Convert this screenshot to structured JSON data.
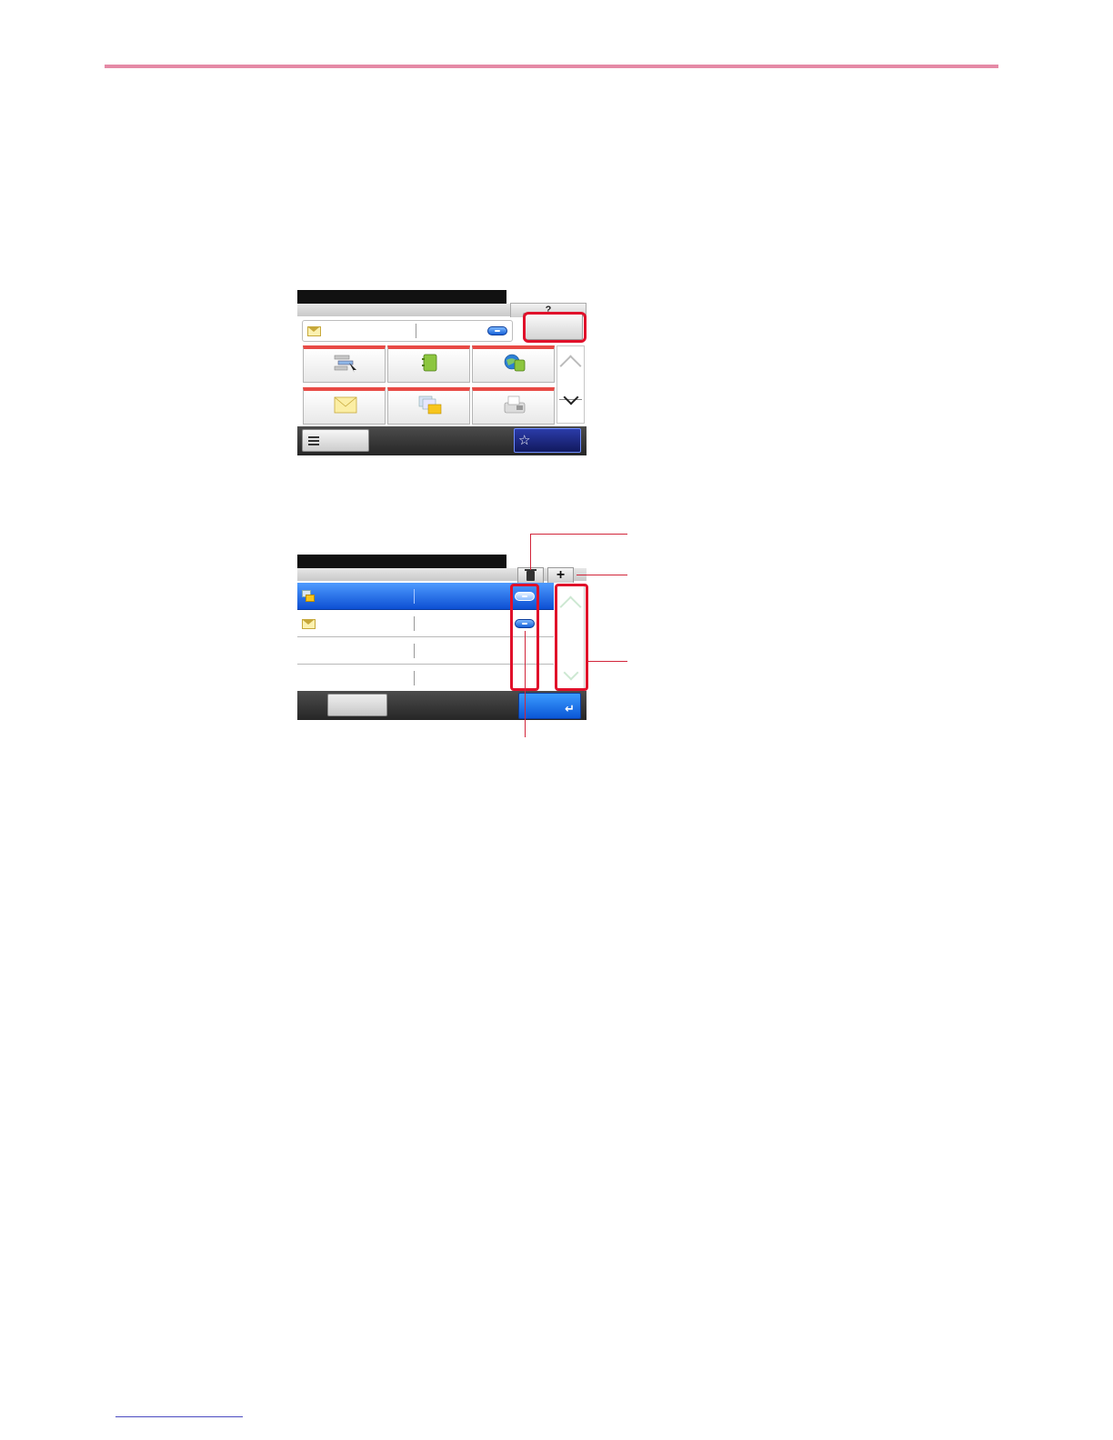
{
  "icons": {
    "help": "help-icon",
    "envelope": "envelope-icon",
    "list": "list-icon",
    "star": "star-icon",
    "trash": "trash-icon",
    "plus": "plus-icon",
    "enter": "enter-icon"
  },
  "screen1": {
    "help_label": "?",
    "favorite_star": "☆"
  },
  "screen2": {
    "add_label": "+",
    "enter_glyph": "↵"
  },
  "colors": {
    "accent_rule": "#e58aa6",
    "highlight": "#e0102a",
    "selected_row": "#0d4fd3"
  }
}
